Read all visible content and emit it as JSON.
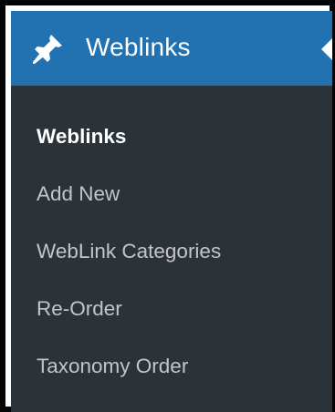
{
  "menu": {
    "header_label": "Weblinks",
    "header_icon": "pin-icon",
    "colors": {
      "header_background": "#2271b1",
      "menu_background": "#2c3338",
      "active_text": "#ffffff",
      "inactive_text": "#c3c4c7"
    },
    "items": [
      {
        "label": "Weblinks",
        "current": true
      },
      {
        "label": "Add New",
        "current": false
      },
      {
        "label": "WebLink Categories",
        "current": false
      },
      {
        "label": "Re-Order",
        "current": false
      },
      {
        "label": "Taxonomy Order",
        "current": false
      }
    ]
  }
}
